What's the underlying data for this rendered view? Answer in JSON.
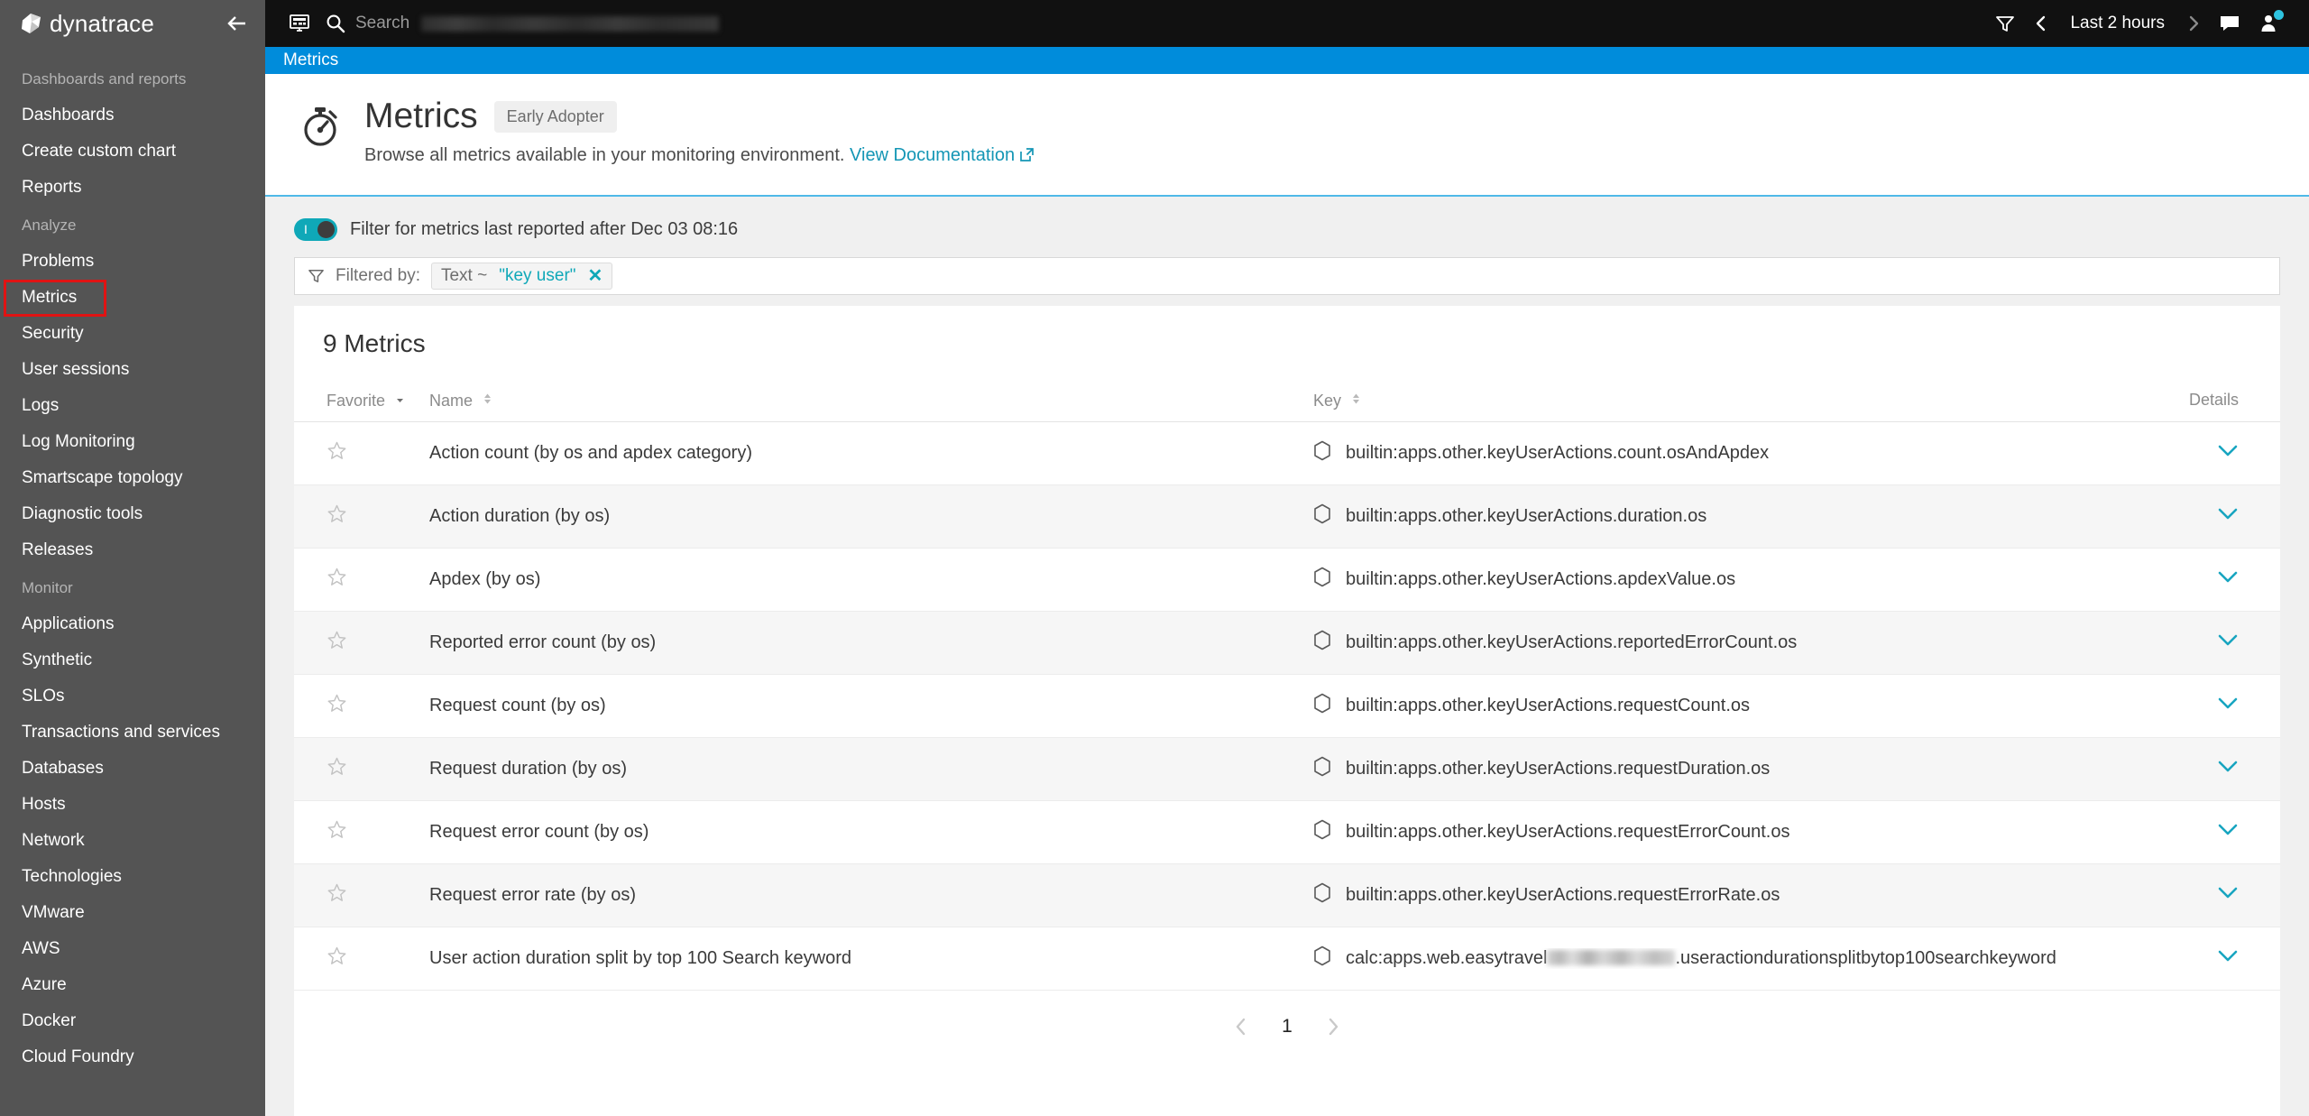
{
  "brand": {
    "name": "dynatrace",
    "logo_icon": "dynatrace-logo-icon",
    "collapse_icon": "arrow-left-icon"
  },
  "topbar": {
    "dashboard_icon": "monitor-icon",
    "search_icon": "search-icon",
    "search_label": "Search",
    "search_value_redacted": true,
    "filter_icon": "funnel-icon",
    "prev_icon": "chevron-left-icon",
    "time_range": "Last 2 hours",
    "next_icon": "chevron-right-icon",
    "feedback_icon": "chat-bubble-icon",
    "avatar_icon": "user-avatar-icon",
    "avatar_badge_color": "#2ec3e0"
  },
  "sidebar": {
    "groups": [
      {
        "label": "Dashboards and reports",
        "items": [
          {
            "label": "Dashboards",
            "highlighted": false
          },
          {
            "label": "Create custom chart",
            "highlighted": false
          },
          {
            "label": "Reports",
            "highlighted": false
          }
        ]
      },
      {
        "label": "Analyze",
        "items": [
          {
            "label": "Problems",
            "highlighted": false
          },
          {
            "label": "Metrics",
            "highlighted": true
          },
          {
            "label": "Security",
            "highlighted": false
          },
          {
            "label": "User sessions",
            "highlighted": false
          },
          {
            "label": "Logs",
            "highlighted": false
          },
          {
            "label": "Log Monitoring",
            "highlighted": false
          },
          {
            "label": "Smartscape topology",
            "highlighted": false
          },
          {
            "label": "Diagnostic tools",
            "highlighted": false
          },
          {
            "label": "Releases",
            "highlighted": false
          }
        ]
      },
      {
        "label": "Monitor",
        "items": [
          {
            "label": "Applications",
            "highlighted": false
          },
          {
            "label": "Synthetic",
            "highlighted": false
          },
          {
            "label": "SLOs",
            "highlighted": false
          },
          {
            "label": "Transactions and services",
            "highlighted": false
          },
          {
            "label": "Databases",
            "highlighted": false
          },
          {
            "label": "Hosts",
            "highlighted": false
          },
          {
            "label": "Network",
            "highlighted": false
          },
          {
            "label": "Technologies",
            "highlighted": false
          },
          {
            "label": "VMware",
            "highlighted": false
          },
          {
            "label": "AWS",
            "highlighted": false
          },
          {
            "label": "Azure",
            "highlighted": false
          },
          {
            "label": "Docker",
            "highlighted": false
          },
          {
            "label": "Cloud Foundry",
            "highlighted": false
          }
        ]
      }
    ],
    "highlight_color": "#e01313"
  },
  "page_tab": {
    "label": "Metrics",
    "accent_color": "#008cdb"
  },
  "header": {
    "icon": "stopwatch-icon",
    "title": "Metrics",
    "badge": "Early Adopter",
    "subtitle": "Browse all metrics available in your monitoring environment.",
    "link_text": "View Documentation",
    "link_icon": "external-link-icon",
    "link_color": "#1496b5"
  },
  "filters": {
    "toggle_on": true,
    "toggle_color": "#0fa8b8",
    "toggle_label": "Filter for metrics last reported after Dec 03 08:16",
    "funnel_icon": "funnel-icon",
    "filtered_by_label": "Filtered by:",
    "chip": {
      "key": "Text ~",
      "value": "\"key user\"",
      "remove_icon": "close-icon"
    }
  },
  "table": {
    "count_title": "9 Metrics",
    "columns": {
      "favorite": "Favorite",
      "favorite_sort": "sort-desc-icon",
      "name": "Name",
      "name_sort": "sort-both-icon",
      "key": "Key",
      "key_sort": "sort-both-icon",
      "details": "Details"
    },
    "rows": [
      {
        "favorite_icon": "star-outline-icon",
        "name": "Action count (by os and apdex category)",
        "key_icon": "hexagon-icon",
        "key": "builtin:apps.other.keyUserActions.count.osAndApdex",
        "key_redacted": false,
        "key_suffix": "",
        "details_icon": "chevron-down-icon"
      },
      {
        "favorite_icon": "star-outline-icon",
        "name": "Action duration (by os)",
        "key_icon": "hexagon-icon",
        "key": "builtin:apps.other.keyUserActions.duration.os",
        "key_redacted": false,
        "key_suffix": "",
        "details_icon": "chevron-down-icon"
      },
      {
        "favorite_icon": "star-outline-icon",
        "name": "Apdex (by os)",
        "key_icon": "hexagon-icon",
        "key": "builtin:apps.other.keyUserActions.apdexValue.os",
        "key_redacted": false,
        "key_suffix": "",
        "details_icon": "chevron-down-icon"
      },
      {
        "favorite_icon": "star-outline-icon",
        "name": "Reported error count (by os)",
        "key_icon": "hexagon-icon",
        "key": "builtin:apps.other.keyUserActions.reportedErrorCount.os",
        "key_redacted": false,
        "key_suffix": "",
        "details_icon": "chevron-down-icon"
      },
      {
        "favorite_icon": "star-outline-icon",
        "name": "Request count (by os)",
        "key_icon": "hexagon-icon",
        "key": "builtin:apps.other.keyUserActions.requestCount.os",
        "key_redacted": false,
        "key_suffix": "",
        "details_icon": "chevron-down-icon"
      },
      {
        "favorite_icon": "star-outline-icon",
        "name": "Request duration (by os)",
        "key_icon": "hexagon-icon",
        "key": "builtin:apps.other.keyUserActions.requestDuration.os",
        "key_redacted": false,
        "key_suffix": "",
        "details_icon": "chevron-down-icon"
      },
      {
        "favorite_icon": "star-outline-icon",
        "name": "Request error count (by os)",
        "key_icon": "hexagon-icon",
        "key": "builtin:apps.other.keyUserActions.requestErrorCount.os",
        "key_redacted": false,
        "key_suffix": "",
        "details_icon": "chevron-down-icon"
      },
      {
        "favorite_icon": "star-outline-icon",
        "name": "Request error rate (by os)",
        "key_icon": "hexagon-icon",
        "key": "builtin:apps.other.keyUserActions.requestErrorRate.os",
        "key_redacted": false,
        "key_suffix": "",
        "details_icon": "chevron-down-icon"
      },
      {
        "favorite_icon": "star-outline-icon",
        "name": "User action duration split by top 100 Search keyword",
        "key_icon": "hexagon-icon",
        "key": "calc:apps.web.easytravel",
        "key_redacted": true,
        "key_suffix": ".useractiondurationsplitbytop100searchkeyword",
        "details_icon": "chevron-down-icon"
      }
    ]
  },
  "pagination": {
    "prev_icon": "chevron-left-icon",
    "current_page": "1",
    "next_icon": "chevron-right-icon"
  }
}
